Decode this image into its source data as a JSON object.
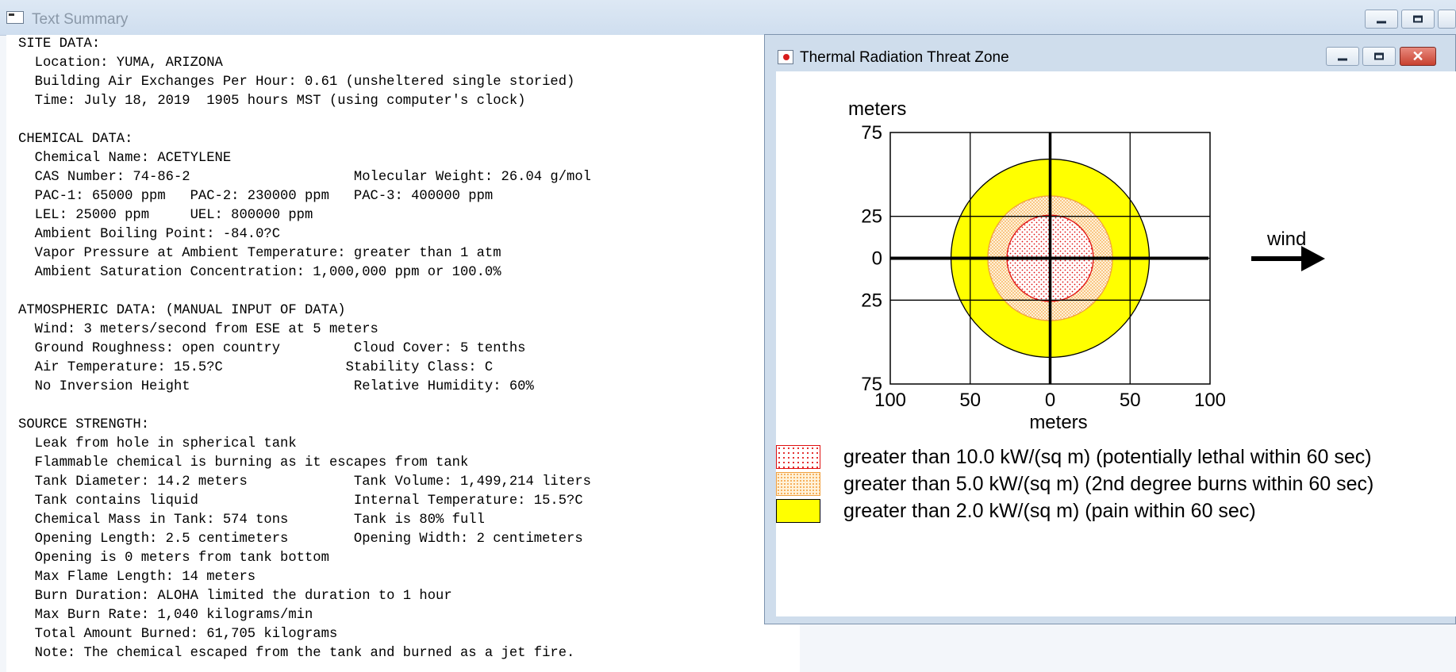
{
  "main_window": {
    "title": "Text Summary"
  },
  "summary_lines": [
    "SITE DATA:",
    "  Location: YUMA, ARIZONA",
    "  Building Air Exchanges Per Hour: 0.61 (unsheltered single storied)",
    "  Time: July 18, 2019  1905 hours MST (using computer's clock)",
    "",
    "CHEMICAL DATA:",
    "  Chemical Name: ACETYLENE",
    "  CAS Number: 74-86-2                    Molecular Weight: 26.04 g/mol",
    "  PAC-1: 65000 ppm   PAC-2: 230000 ppm   PAC-3: 400000 ppm",
    "  LEL: 25000 ppm     UEL: 800000 ppm",
    "  Ambient Boiling Point: -84.0?C",
    "  Vapor Pressure at Ambient Temperature: greater than 1 atm",
    "  Ambient Saturation Concentration: 1,000,000 ppm or 100.0%",
    "",
    "ATMOSPHERIC DATA: (MANUAL INPUT OF DATA)",
    "  Wind: 3 meters/second from ESE at 5 meters",
    "  Ground Roughness: open country         Cloud Cover: 5 tenths",
    "  Air Temperature: 15.5?C               Stability Class: C",
    "  No Inversion Height                    Relative Humidity: 60%",
    "",
    "SOURCE STRENGTH:",
    "  Leak from hole in spherical tank",
    "  Flammable chemical is burning as it escapes from tank",
    "  Tank Diameter: 14.2 meters             Tank Volume: 1,499,214 liters",
    "  Tank contains liquid                   Internal Temperature: 15.5?C",
    "  Chemical Mass in Tank: 574 tons        Tank is 80% full",
    "  Opening Length: 2.5 centimeters        Opening Width: 2 centimeters",
    "  Opening is 0 meters from tank bottom",
    "  Max Flame Length: 14 meters",
    "  Burn Duration: ALOHA limited the duration to 1 hour",
    "  Max Burn Rate: 1,040 kilograms/min",
    "  Total Amount Burned: 61,705 kilograms",
    "  Note: The chemical escaped from the tank and burned as a jet fire."
  ],
  "threat_zone_window": {
    "title": "Thermal Radiation Threat Zone",
    "wind_label": "wind"
  },
  "chart_data": {
    "type": "threat-zone",
    "xlabel": "meters",
    "ylabel": "meters",
    "xlim": [
      -100,
      100
    ],
    "ylim": [
      -75,
      75
    ],
    "x_tick_labels": [
      "100",
      "50",
      "0",
      "50",
      "100"
    ],
    "y_tick_labels": [
      "75",
      "25",
      "0",
      "25",
      "75"
    ],
    "x_ticks": [
      -100,
      -50,
      0,
      50,
      100
    ],
    "y_ticks": [
      75,
      25,
      0,
      -25,
      -75
    ],
    "grid": true,
    "zones": [
      {
        "level": "pain",
        "threshold_kw_per_m2": 2.0,
        "radius_m": 62,
        "color": "#ffff00",
        "pattern": "solid",
        "legend": "greater than 2.0 kW/(sq m) (pain within 60 sec)"
      },
      {
        "level": "2nd-degree-burns",
        "threshold_kw_per_m2": 5.0,
        "radius_m": 39,
        "color": "#ff8c00",
        "pattern": "dots",
        "legend": "greater than 5.0 kW/(sq m) (2nd degree burns within 60 sec)"
      },
      {
        "level": "lethal",
        "threshold_kw_per_m2": 10.0,
        "radius_m": 27,
        "color": "#ff0000",
        "pattern": "dots",
        "legend": "greater than 10.0 kW/(sq m) (potentially lethal within 60 sec)"
      }
    ]
  }
}
